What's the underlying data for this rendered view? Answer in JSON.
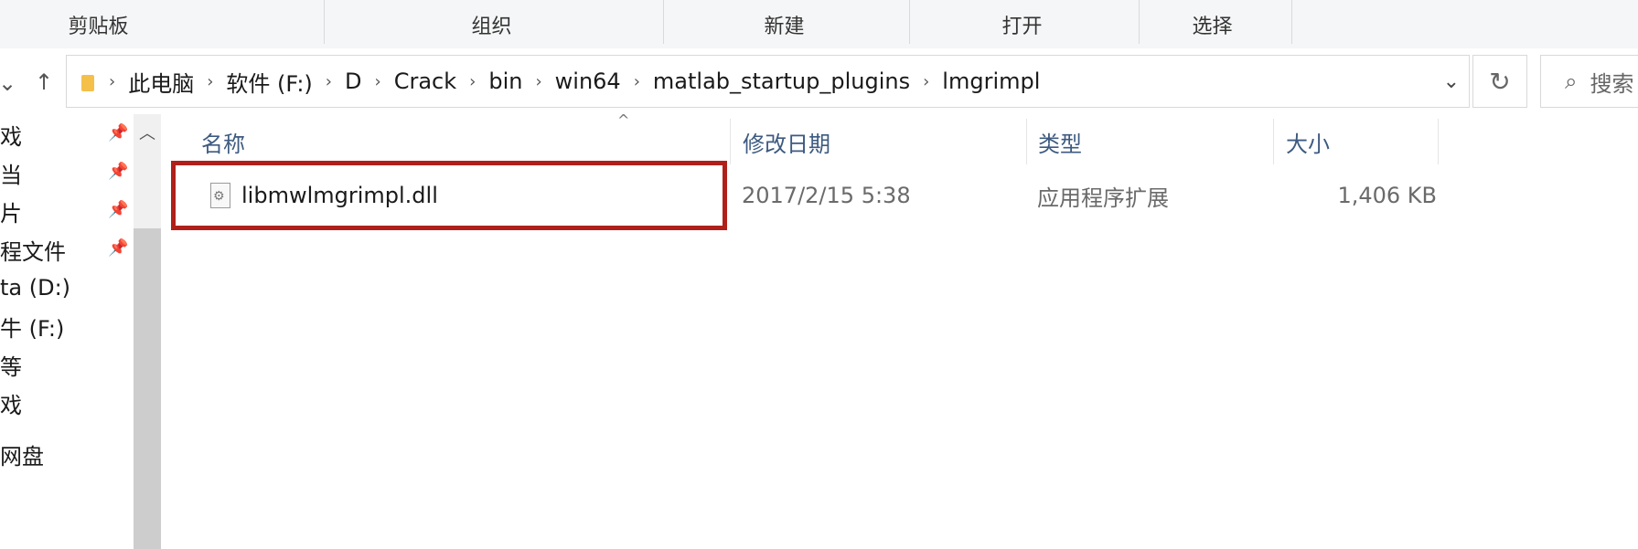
{
  "ribbon": {
    "groups": [
      "剪贴板",
      "组织",
      "新建",
      "打开",
      "选择"
    ]
  },
  "navigation": {
    "back_icon": "chevron-down-icon",
    "up_icon": "up-arrow-icon",
    "breadcrumbs": [
      "此电脑",
      "软件 (F:)",
      "D",
      "Crack",
      "bin",
      "win64",
      "matlab_startup_plugins",
      "lmgrimpl"
    ],
    "refresh_icon": "refresh-icon",
    "search_placeholder": "搜索"
  },
  "sidebar": {
    "items": [
      {
        "label": "戏",
        "pinned": true
      },
      {
        "label": "当",
        "pinned": true
      },
      {
        "label": "片",
        "pinned": true
      },
      {
        "label": "程文件",
        "pinned": true
      },
      {
        "label": "ta (D:)",
        "pinned": false
      },
      {
        "label": "牛 (F:)",
        "pinned": false
      },
      {
        "label": "等",
        "pinned": false
      },
      {
        "label": "戏",
        "pinned": false
      },
      {
        "label": "网盘",
        "pinned": false
      }
    ]
  },
  "file_list": {
    "columns": [
      "名称",
      "修改日期",
      "类型",
      "大小"
    ],
    "rows": [
      {
        "name": "libmwlmgrimpl.dll",
        "modified": "2017/2/15 5:38",
        "type": "应用程序扩展",
        "size": "1,406 KB",
        "highlighted": true
      }
    ]
  },
  "colors": {
    "highlight_border": "#b0201a",
    "header_text": "#3d5a80",
    "folder": "#f4c04a"
  }
}
